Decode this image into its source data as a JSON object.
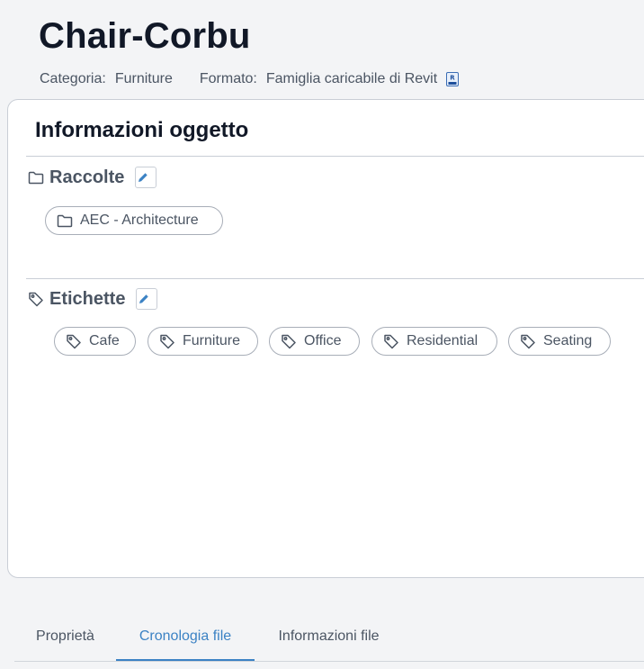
{
  "header": {
    "title": "Chair-Corbu",
    "category_label": "Categoria:",
    "category_value": "Furniture",
    "format_label": "Formato:",
    "format_value": "Famiglia caricabile di Revit",
    "format_icon": "revit-file-icon"
  },
  "card": {
    "title": "Informazioni oggetto",
    "collections": {
      "heading": "Raccolte",
      "icon": "folder-icon",
      "edit_icon": "pencil-icon",
      "items": [
        "AEC - Architecture"
      ]
    },
    "tags": {
      "heading": "Etichette",
      "icon": "tag-icon",
      "edit_icon": "pencil-icon",
      "items": [
        "Cafe",
        "Furniture",
        "Office",
        "Residential",
        "Seating"
      ]
    }
  },
  "tabs": {
    "items": [
      "Proprietà",
      "Cronologia file",
      "Informazioni file"
    ],
    "active": "Cronologia file"
  },
  "colors": {
    "accent": "#3b82c4",
    "text": "#111827",
    "muted": "#4b5563",
    "border": "#c9ced6",
    "background": "#f3f4f6"
  }
}
